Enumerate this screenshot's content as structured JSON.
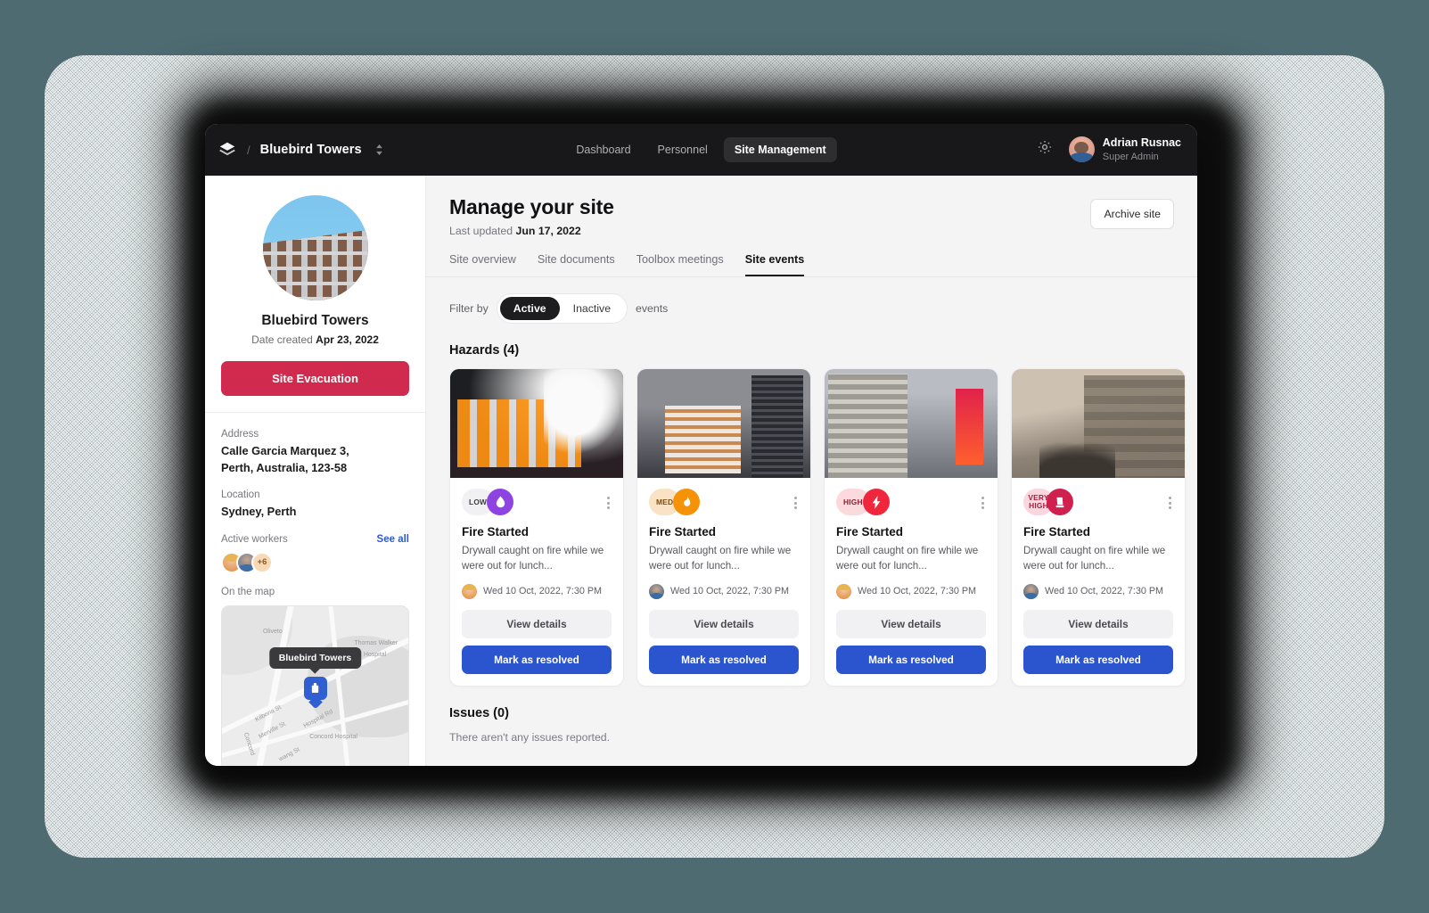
{
  "topbar": {
    "logo_icon": "layers-icon",
    "separator": "/",
    "site_name": "Bluebird Towers",
    "site_switcher_icon": "chevron-up-down-icon",
    "nav": [
      {
        "label": "Dashboard",
        "active": false
      },
      {
        "label": "Personnel",
        "active": false
      },
      {
        "label": "Site Management",
        "active": true
      }
    ],
    "settings_icon": "gear-icon",
    "user": {
      "name": "Adrian Rusnac",
      "role": "Super Admin",
      "avatar": "user-avatar"
    }
  },
  "sidebar": {
    "site_photo_alt": "site-photo",
    "site_name": "Bluebird Towers",
    "date_created_label": "Date created",
    "date_created_value": "Apr 23, 2022",
    "evacuation_button": "Site Evacuation",
    "address_label": "Address",
    "address_line1": "Calle Garcia Marquez 3,",
    "address_line2": "Perth, Australia, 123-58",
    "location_label": "Location",
    "location_value": "Sydney, Perth",
    "active_workers_label": "Active workers",
    "see_all_label": "See all",
    "workers_overflow": "+6",
    "map_label": "On the map",
    "map_pin_tooltip": "Bluebird Towers",
    "map_labels": [
      "Oliveto",
      "Thomas Walker",
      "Hospital",
      "Kilbona St",
      "Merville St",
      "Hospital Rd",
      "Concord Hospital",
      "Concord",
      "wang St"
    ]
  },
  "main": {
    "title": "Manage your site",
    "last_updated_label": "Last updated",
    "last_updated_value": "Jun 17, 2022",
    "archive_button": "Archive site",
    "tabs": [
      {
        "label": "Site overview",
        "active": false
      },
      {
        "label": "Site documents",
        "active": false
      },
      {
        "label": "Toolbox meetings",
        "active": false
      },
      {
        "label": "Site events",
        "active": true
      }
    ],
    "filter_label": "Filter by",
    "filter_options": [
      {
        "label": "Active",
        "selected": true
      },
      {
        "label": "Inactive",
        "selected": false
      }
    ],
    "filter_suffix": "events",
    "hazards_title": "Hazards (4)",
    "issues_title": "Issues (0)",
    "issues_empty": "There aren't any issues reported.",
    "view_details_label": "View details",
    "mark_resolved_label": "Mark as resolved",
    "kebab_icon": "more-vertical-icon",
    "hazards": [
      {
        "severity": "LOW",
        "severity_color": "#8e44e0",
        "severity_bg": "#f1f0f3",
        "severity_text_color": "#3c3c42",
        "icon": "water-drop-icon",
        "title": "Fire Started",
        "description": "Drywall caught on fire while we were out for lunch...",
        "timestamp": "Wed 10 Oct, 2022, 7:30 PM",
        "reporter_avatar": "a1",
        "image": "img1"
      },
      {
        "severity": "MED",
        "severity_color": "#f59208",
        "severity_bg": "#fae2c4",
        "severity_text_color": "#7c4a10",
        "icon": "flame-icon",
        "title": "Fire Started",
        "description": "Drywall caught on fire while we were out for lunch...",
        "timestamp": "Wed 10 Oct, 2022, 7:30 PM",
        "reporter_avatar": "a2",
        "image": "img2"
      },
      {
        "severity": "HIGH",
        "severity_color": "#f0263c",
        "severity_bg": "#fbd9dc",
        "severity_text_color": "#8d1f2c",
        "icon": "lightning-bolt-icon",
        "title": "Fire Started",
        "description": "Drywall caught on fire while we were out for lunch...",
        "timestamp": "Wed 10 Oct, 2022, 7:30 PM",
        "reporter_avatar": "a1",
        "image": "img3"
      },
      {
        "severity": "VERY HIGH",
        "severity_color": "#cf2050",
        "severity_bg": "#fbd6de",
        "severity_text_color": "#a3203f",
        "icon": "building-collapse-icon",
        "title": "Fire Started",
        "description": "Drywall caught on fire while we were out for lunch...",
        "timestamp": "Wed 10 Oct, 2022, 7:30 PM",
        "reporter_avatar": "a2",
        "image": "img4"
      }
    ]
  }
}
